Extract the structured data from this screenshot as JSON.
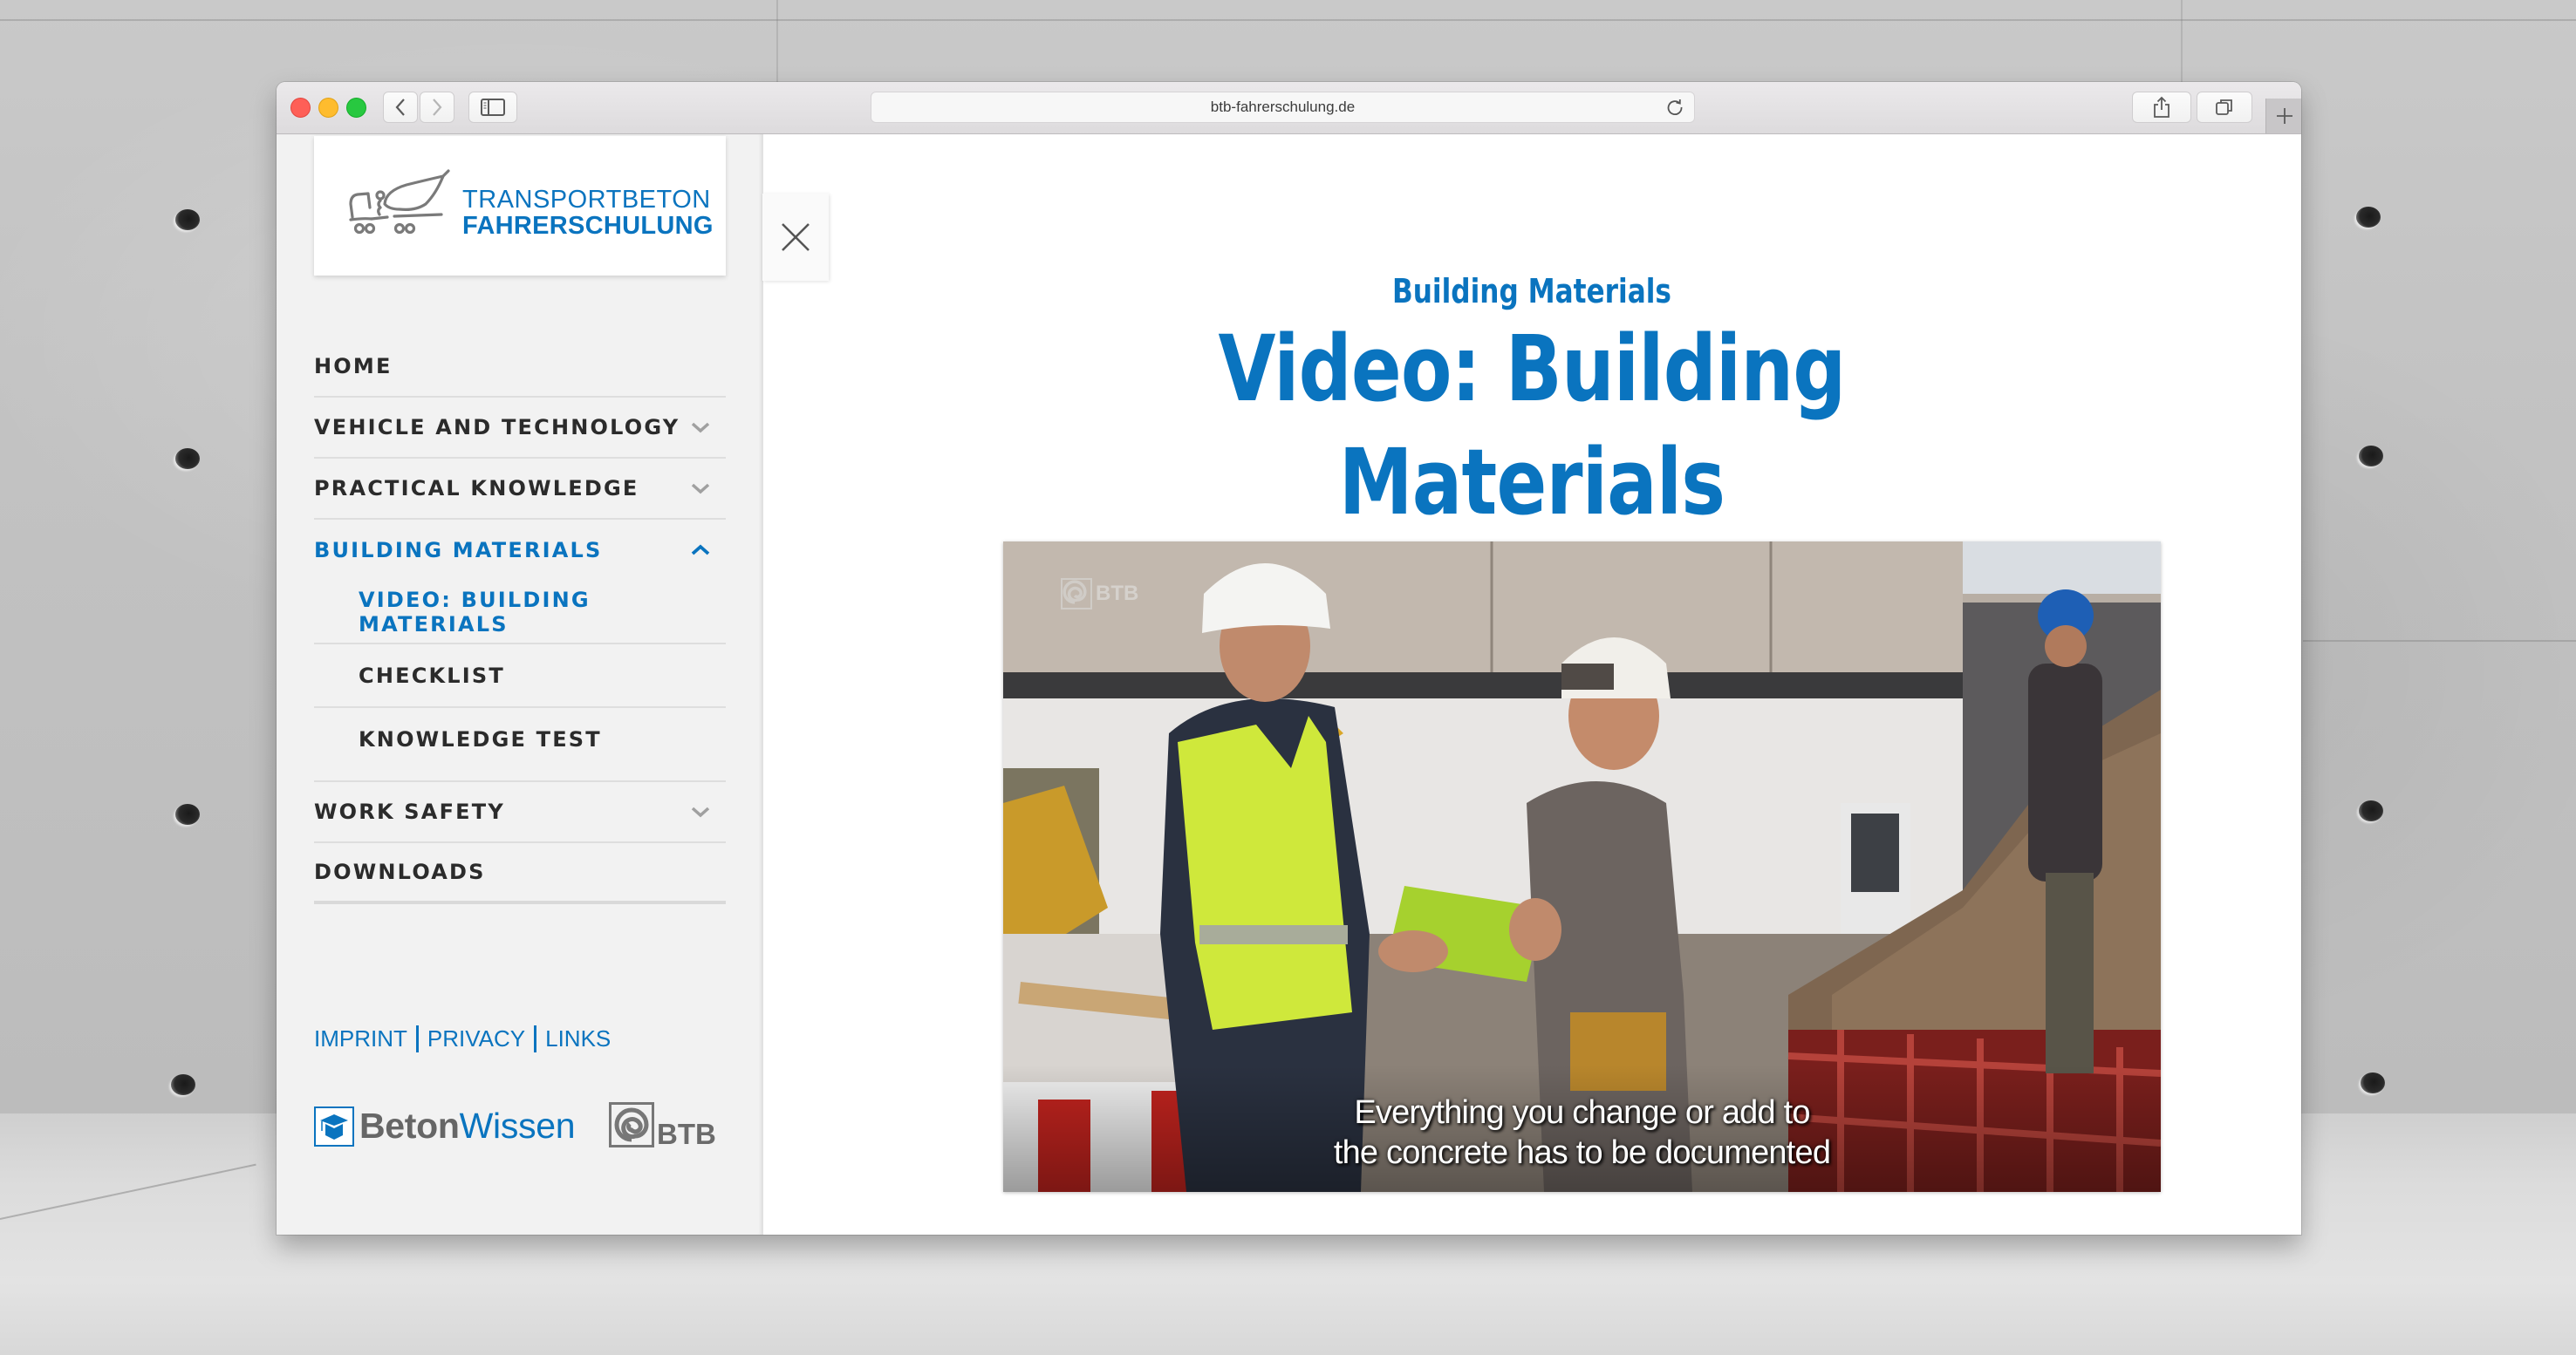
{
  "browser": {
    "url": "btb-fahrerschulung.de",
    "icons": {
      "close": "close-window-icon",
      "minimize": "minimize-window-icon",
      "zoom": "zoom-window-icon",
      "back": "chevron-left-icon",
      "forward": "chevron-right-icon",
      "sidebar": "sidebar-toggle-icon",
      "reload": "reload-icon",
      "share": "share-icon",
      "tabs": "tab-overview-icon",
      "new_tab": "plus-icon"
    }
  },
  "sidebar": {
    "logo": {
      "line1": "TRANSPORTBETON",
      "line2": "FAHRERSCHULUNG"
    },
    "nav": [
      {
        "label": "HOME",
        "expandable": false,
        "active": false,
        "level": 0
      },
      {
        "label": "VEHICLE AND TECHNOLOGY",
        "expandable": true,
        "expanded": false,
        "active": false,
        "level": 0
      },
      {
        "label": "PRACTICAL KNOWLEDGE",
        "expandable": true,
        "expanded": false,
        "active": false,
        "level": 0
      },
      {
        "label": "BUILDING MATERIALS",
        "expandable": true,
        "expanded": true,
        "active": true,
        "level": 0
      },
      {
        "label": "VIDEO: BUILDING MATERIALS",
        "expandable": false,
        "active": true,
        "level": 1
      },
      {
        "label": "CHECKLIST",
        "expandable": false,
        "active": false,
        "level": 1
      },
      {
        "label": "KNOWLEDGE TEST",
        "expandable": false,
        "active": false,
        "level": 1
      },
      {
        "label": "WORK SAFETY",
        "expandable": true,
        "expanded": false,
        "active": false,
        "level": 0
      },
      {
        "label": "DOWNLOADS",
        "expandable": false,
        "active": false,
        "level": 0
      }
    ],
    "footer_links": [
      "IMPRINT",
      "PRIVACY",
      "LINKS"
    ],
    "partners": {
      "betonwissen_part1": "Beton",
      "betonwissen_part2": "Wissen",
      "btb": "BTB"
    }
  },
  "main": {
    "close_label": "close-icon",
    "subtitle": "Building Materials",
    "title_line1": "Video: Building",
    "title_line2": "Materials",
    "video": {
      "watermark": "BTB",
      "caption_line1": "Everything you change or add to",
      "caption_line2": "the concrete has to be documented"
    }
  },
  "colors": {
    "brand_blue": "#0a74bf",
    "nav_text": "#2b2b2b",
    "sidebar_bg": "#f2f2f2",
    "chevron_gray": "#a0a0a0"
  }
}
